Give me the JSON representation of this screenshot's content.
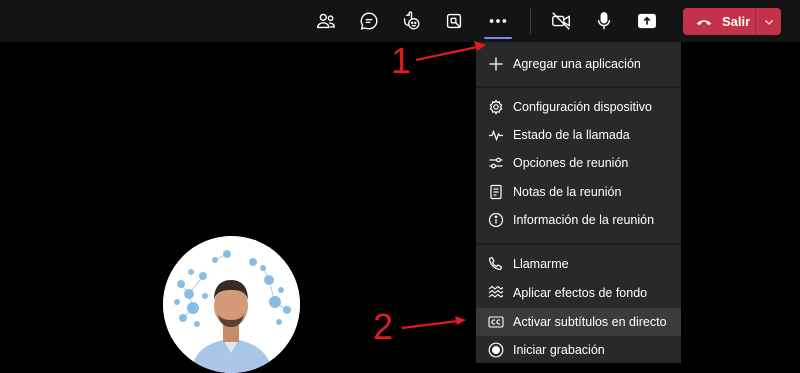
{
  "toolbar": {
    "buttons": [
      {
        "icon": "people-icon"
      },
      {
        "icon": "chat-icon"
      },
      {
        "icon": "reactions-icon"
      },
      {
        "icon": "rooms-icon"
      },
      {
        "icon": "more-icon"
      },
      {
        "icon": "camera-off-icon"
      },
      {
        "icon": "mic-icon"
      },
      {
        "icon": "share-icon"
      }
    ],
    "leave_label": "Salir"
  },
  "menu": {
    "items": [
      {
        "label": "Agregar una aplicación",
        "icon": "plus-icon"
      },
      {
        "label": "Configuración dispositivo",
        "icon": "gear-icon"
      },
      {
        "label": "Estado de la llamada",
        "icon": "pulse-icon"
      },
      {
        "label": "Opciones de reunión",
        "icon": "sliders-icon"
      },
      {
        "label": "Notas de la reunión",
        "icon": "notes-icon"
      },
      {
        "label": "Información de la reunión",
        "icon": "info-icon"
      },
      {
        "label": "Llamarme",
        "icon": "phone-icon"
      },
      {
        "label": "Aplicar efectos de fondo",
        "icon": "background-effects-icon"
      },
      {
        "label": "Activar subtítulos en directo",
        "icon": "cc-icon",
        "highlighted": true
      },
      {
        "label": "Iniciar grabación",
        "icon": "record-icon"
      }
    ]
  },
  "annotations": {
    "one": "1",
    "two": "2"
  },
  "colors": {
    "leave_button": "#c4314b",
    "menu_background": "#292929",
    "annotation": "#e01b22",
    "active_indicator": "#7f85f5"
  }
}
